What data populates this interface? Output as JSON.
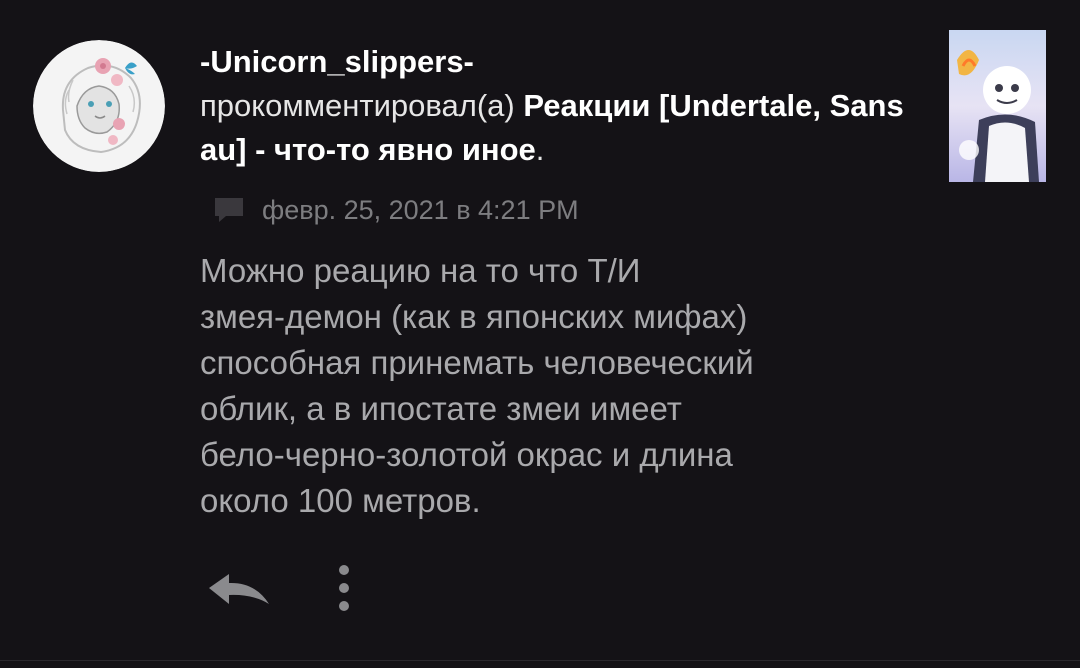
{
  "notification": {
    "username": "-Unicorn_slippers-",
    "action": "прокомментировал(а)",
    "post_title": "Реакции [Undertale, Sans au] - что-то явно иное",
    "title_suffix": ".",
    "timestamp": "февр. 25, 2021 в 4:21 PM",
    "comment_lines": [
      "Можно реацию на то что Т/И",
      "змея-демон (как в японских мифах)",
      "способная принемать человеческий",
      "облик, а в ипостате змеи имеет",
      "бело-черно-золотой окрас и длина",
      "около 100 метров."
    ]
  },
  "icons": {
    "meta": "comment-bubble-icon",
    "reply": "reply-arrow-icon",
    "more": "vertical-dots-icon"
  },
  "colors": {
    "background": "#141216",
    "username": "#ffffff",
    "action_text": "#e6e6e6",
    "timestamp": "#7d7d80",
    "comment_text": "#a9a9ac",
    "icon": "#8a8a8d"
  }
}
